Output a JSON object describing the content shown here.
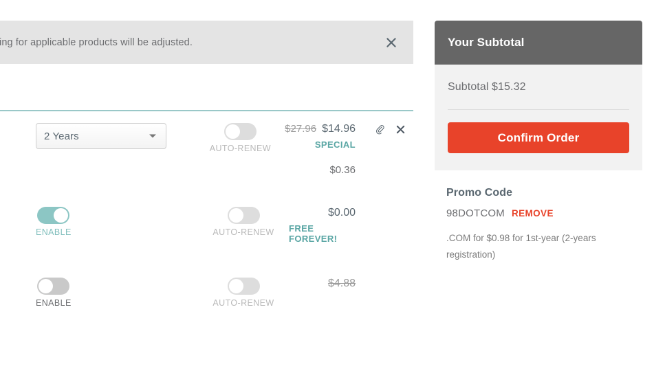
{
  "notice": {
    "message": "ing for applicable products will be adjusted.",
    "close_icon": "close-icon"
  },
  "rows": [
    {
      "term_label": "2 Years",
      "term_caret_icon": "chevron-down-icon",
      "autorenew_label": "AUTO-RENEW",
      "price_old": "$27.96",
      "price_new": "$14.96",
      "price_tag": "SPECIAL",
      "price_sub": "$0.36",
      "attach_icon": "paperclip-icon",
      "remove_icon": "close-icon"
    },
    {
      "enable_label": "ENABLE",
      "autorenew_label": "AUTO-RENEW",
      "price": "$0.00",
      "price_tag": "FREE FOREVER!"
    },
    {
      "enable_label": "ENABLE",
      "autorenew_label": "AUTO-RENEW",
      "price": "$4.88"
    }
  ],
  "sidebar": {
    "subtotal_title": "Your Subtotal",
    "subtotal_amount": "Subtotal $15.32",
    "confirm_label": "Confirm Order",
    "promo_title": "Promo Code",
    "promo_code": "98DOTCOM",
    "promo_remove_label": "REMOVE",
    "promo_description": ".COM for $0.98 for 1st-year (2-years registration)"
  },
  "colors": {
    "teal": "#8cc6c4",
    "teal_text": "#5aa6a4",
    "red": "#e8432a",
    "banner_gray": "#e4e4e4",
    "head_gray": "#666666",
    "text_gray": "#6d6e71"
  }
}
